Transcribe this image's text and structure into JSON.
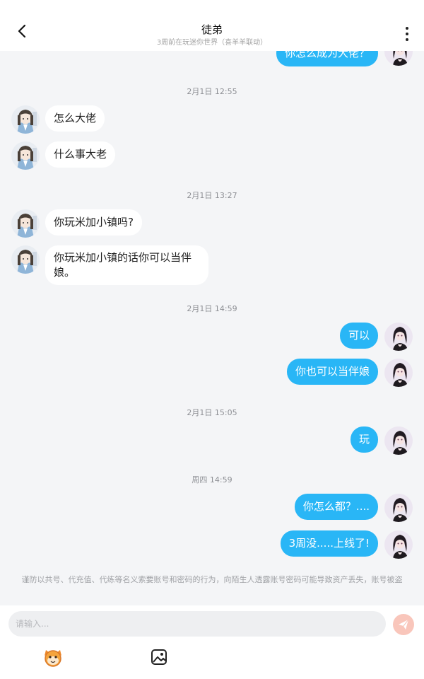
{
  "header": {
    "title": "徒弟",
    "subtitle": "3周前在玩迷你世界（喜羊羊联动）",
    "back_icon": "chevron-left-icon",
    "more_icon": "more-vertical-icon"
  },
  "messages": [
    {
      "side": "right",
      "text": "你怎么成为大佬？",
      "partial": true
    },
    {
      "timestamp": "2月1日 12:55"
    },
    {
      "side": "left",
      "text": "怎么大佬"
    },
    {
      "side": "left",
      "text": "什么事大老"
    },
    {
      "timestamp": "2月1日 13:27"
    },
    {
      "side": "left",
      "text": "你玩米加小镇吗?"
    },
    {
      "side": "left",
      "text": "你玩米加小镇的话你可以当伴娘。"
    },
    {
      "timestamp": "2月1日 14:59"
    },
    {
      "side": "right",
      "text": "可以"
    },
    {
      "side": "right",
      "text": "你也可以当伴娘"
    },
    {
      "timestamp": "2月1日 15:05"
    },
    {
      "side": "right",
      "text": "玩"
    },
    {
      "timestamp": "周四 14:59"
    },
    {
      "side": "right",
      "text": "你怎么都？...."
    },
    {
      "side": "right",
      "text": "3周没.....上线了!"
    }
  ],
  "notice": "谨防以共号、代充值、代练等名义索要账号和密码的行为，向陌生人透露账号密码可能导致资产丢失，账号被盗",
  "composer": {
    "placeholder": "请输入...",
    "send_icon": "send-icon",
    "emoji_icon": "emoji-icon",
    "image_icon": "image-icon"
  },
  "colors": {
    "self_bubble": "#29b6f6",
    "other_bubble": "#ffffff",
    "background": "#f4f5f7",
    "send_button": "#f9c6bb"
  }
}
